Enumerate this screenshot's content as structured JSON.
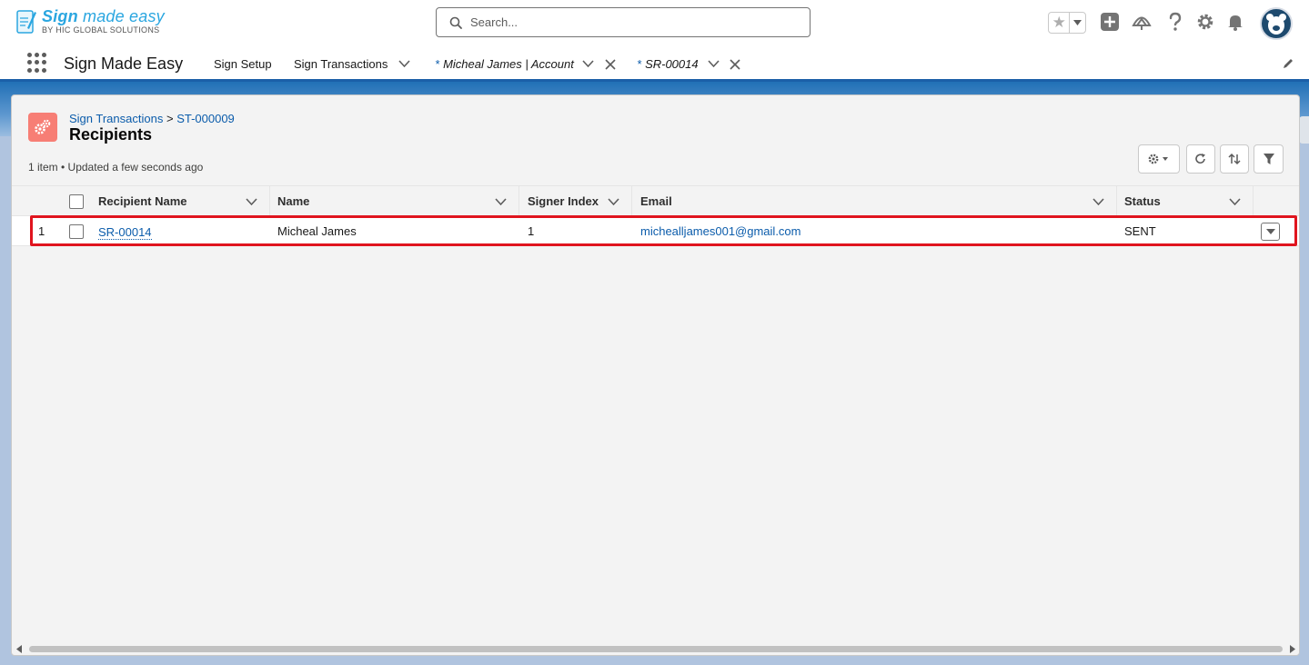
{
  "brand": {
    "title_bold": "Sign",
    "title_rest": "made easy",
    "subtitle": "BY HIC GLOBAL SOLUTIONS"
  },
  "search": {
    "placeholder": "Search..."
  },
  "header_icons": [
    "star-icon",
    "chevron-down-icon",
    "add-icon",
    "trailhead-icon",
    "help-icon",
    "setup-gear-icon",
    "notification-bell-icon",
    "avatar"
  ],
  "nav": {
    "app_name": "Sign Made Easy",
    "items": [
      {
        "label": "Sign Setup"
      },
      {
        "label": "Sign Transactions"
      }
    ],
    "tabs": [
      {
        "modified": "*",
        "label": "Micheal James | Account"
      },
      {
        "modified": "*",
        "label": "SR-00014"
      }
    ]
  },
  "page": {
    "breadcrumb_parent": "Sign Transactions",
    "breadcrumb_sep": ">",
    "breadcrumb_record": "ST-000009",
    "title": "Recipients",
    "meta": "1 item • Updated a few seconds ago"
  },
  "toolbar": [
    "list-settings-icon",
    "refresh-icon",
    "sort-icon",
    "filter-icon"
  ],
  "table": {
    "columns": [
      "Recipient Name",
      "Name",
      "Signer Index",
      "Email",
      "Status"
    ],
    "rows": [
      {
        "num": "1",
        "recipient_name": "SR-00014",
        "name": "Micheal James",
        "signer_index": "1",
        "email": "michealljames001@gmail.com",
        "status": "SENT"
      }
    ]
  },
  "colors": {
    "brand_blue": "#2aa6e0",
    "link": "#0b5cab",
    "object_icon": "#f77e75",
    "highlight": "#e0141e",
    "nav_accent": "#1b5fa8"
  }
}
